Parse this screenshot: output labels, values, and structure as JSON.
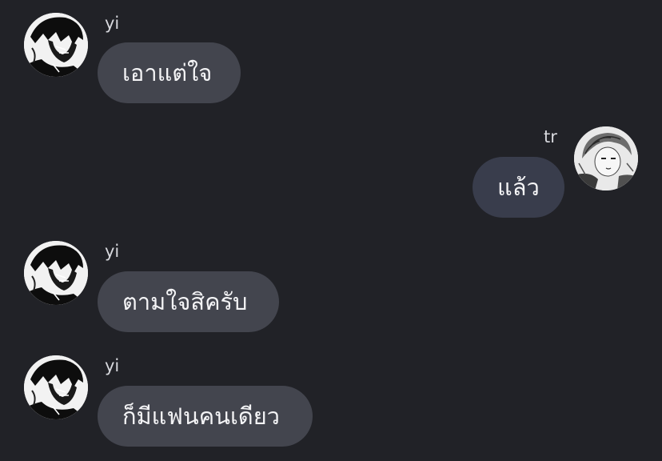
{
  "colors": {
    "background": "#212227",
    "incoming_bubble": "#43454e",
    "outgoing_bubble": "#393d4c",
    "text": "#f4f4f6",
    "sender_text": "#d8d9de"
  },
  "messages": [
    {
      "sender": "yi",
      "direction": "incoming",
      "text": "เอาแต่ใจ",
      "avatar_icon": "manga-avatar-icon"
    },
    {
      "sender": "tr",
      "direction": "outgoing",
      "text": "แล้ว",
      "avatar_icon": "manga-avatar-icon"
    },
    {
      "sender": "yi",
      "direction": "incoming",
      "text": "ตามใจสิครับ",
      "avatar_icon": "manga-avatar-icon"
    },
    {
      "sender": "yi",
      "direction": "incoming",
      "text": "ก็มีแฟนคนเดียว",
      "avatar_icon": "manga-avatar-icon"
    }
  ]
}
